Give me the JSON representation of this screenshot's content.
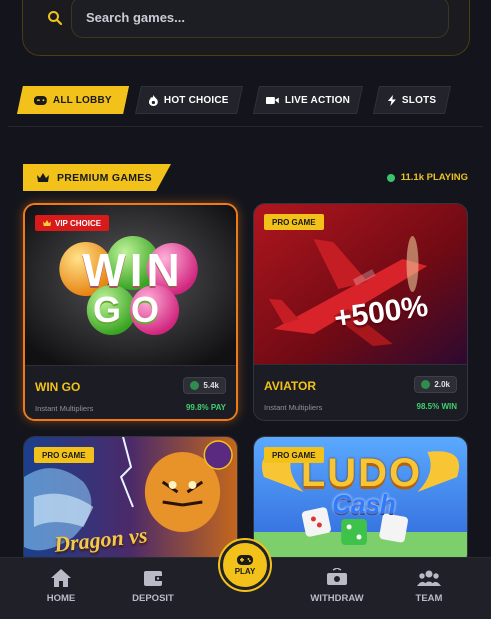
{
  "search": {
    "placeholder": "Search games..."
  },
  "tabs": [
    {
      "label": "ALL LOBBY",
      "icon": "gamepad-icon"
    },
    {
      "label": "HOT CHOICE",
      "icon": "fire-icon"
    },
    {
      "label": "LIVE ACTION",
      "icon": "video-camera-icon"
    },
    {
      "label": "SLOTS",
      "icon": "lightning-icon"
    }
  ],
  "section": {
    "title": "PREMIUM GAMES",
    "playing": "11.1k PLAYING"
  },
  "games": [
    {
      "badge": "VIP CHOICE",
      "title": "WIN GO",
      "subtitle": "Instant Multipliers",
      "count": "5.4k",
      "payout": "99.8% PAY",
      "art_line1": "WIN",
      "art_line2": "GO"
    },
    {
      "badge": "PRO GAME",
      "title": "AVIATOR",
      "subtitle": "Instant Multipliers",
      "count": "2.0k",
      "payout": "98.5% WIN",
      "art_text": "+500%"
    },
    {
      "badge": "PRO GAME",
      "art_text": "Dragon vs"
    },
    {
      "badge": "PRO GAME",
      "art_line1": "LUDO",
      "art_line2": "Cash"
    }
  ],
  "nav": {
    "home": "HOME",
    "deposit": "DEPOSIT",
    "play": "PLAY",
    "withdraw": "WITHDRAW",
    "team": "TEAM"
  },
  "colors": {
    "accent": "#f2c21a",
    "background": "#14151c",
    "positive": "#3fd06f",
    "vip": "#d71a1a"
  }
}
